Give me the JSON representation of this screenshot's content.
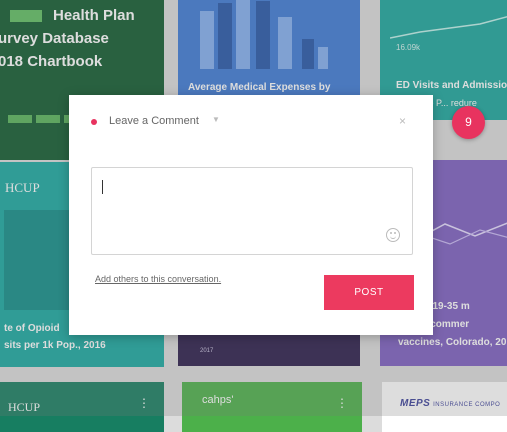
{
  "tiles": {
    "health_plan": {
      "title_lines": [
        "Health Plan",
        "urvey Database",
        "018 Chartbook"
      ]
    },
    "medical_expenses": {
      "caption": "Average Medical Expenses by"
    },
    "ed_visits": {
      "value": "16.09k",
      "title": "ED Visits and Admissio",
      "subtitle": "lve P... redure"
    },
    "opioid": {
      "logo": "HCUP",
      "caption_lines": [
        "te of Opioid",
        "sits per 1k Pop., 2016"
      ]
    },
    "navy": {
      "year": "2017"
    },
    "vaccines": {
      "caption_lines": [
        "n ages 19-35 m",
        "d all recommer",
        "vaccines, Colorado, 20"
      ]
    },
    "bottom": {
      "hcup": "HCUP",
      "dots": "⋮",
      "cahps": "cahps'",
      "meps": "MEPS",
      "meps_sub": "INSURANCE COMPO"
    }
  },
  "dialog": {
    "title": "Leave a Comment",
    "caret": "▼",
    "close": "×",
    "textarea_value": "",
    "add_others": "Add others to this conversation.",
    "post_label": "POST"
  },
  "badge": {
    "count": "9"
  },
  "colors": {
    "accent": "#ec3a5f",
    "health_green": "#0f5a2e",
    "blue": "#3c7ad6",
    "teal": "#18a8a0",
    "purple": "#7d5ec0",
    "navy": "#2a1b4a"
  }
}
